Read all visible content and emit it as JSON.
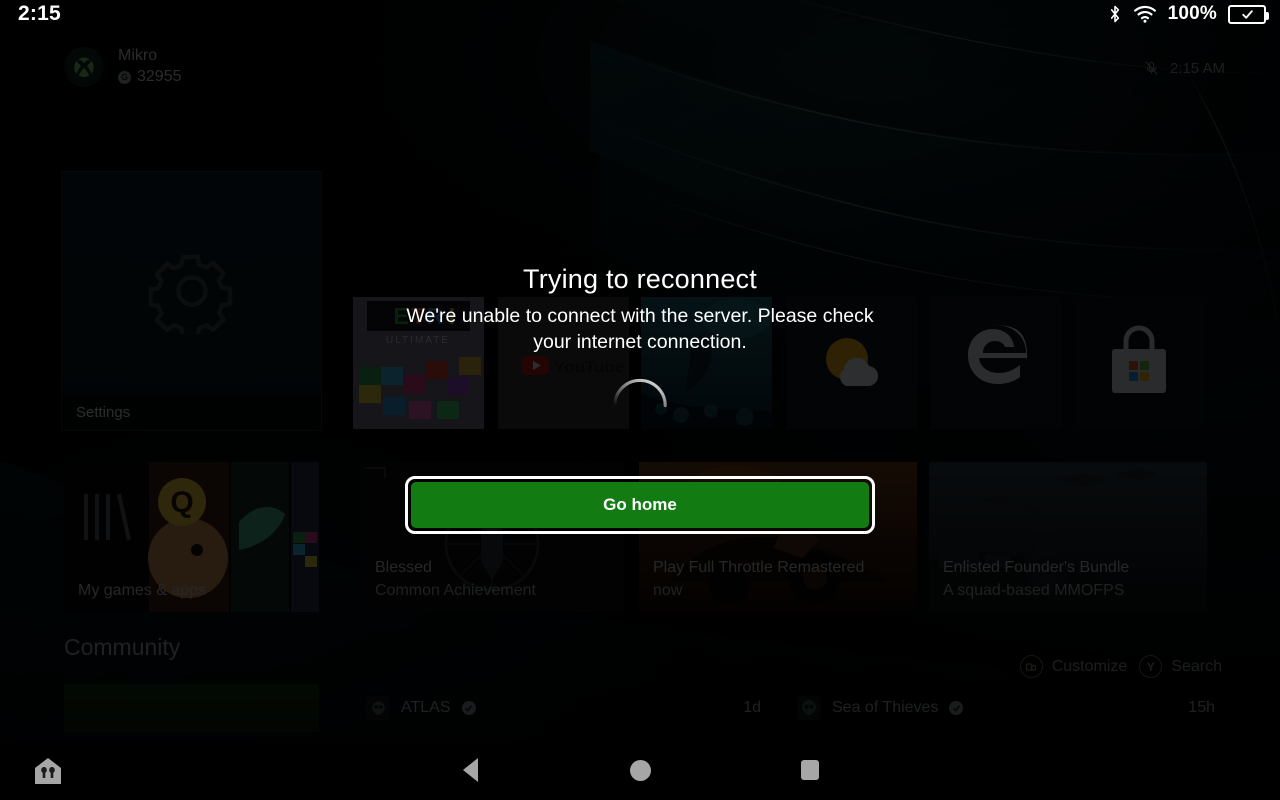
{
  "status_bar": {
    "time": "2:15",
    "battery_percent": "100%",
    "icons": [
      "bluetooth-icon",
      "wifi-icon",
      "battery-charged-icon"
    ]
  },
  "dashboard": {
    "profile": {
      "gamertag": "Mikro",
      "gamerscore": "32955",
      "gamerscore_badge": "G",
      "avatar_icon": "xbox-logo-icon"
    },
    "clock": {
      "time": "2:15 AM",
      "mic_icon": "microphone-muted-icon"
    },
    "pinned_tiles": [
      {
        "label": "Settings",
        "icon": "gear-icon"
      },
      {
        "label": "Tetris Ultimate",
        "icon": "tetris-tile-icon"
      },
      {
        "label": "YouTube",
        "icon": "youtube-icon"
      },
      {
        "label": "Subnautica",
        "icon": "diver-art-icon"
      },
      {
        "label": "Weather",
        "icon": "weather-sun-cloud-icon"
      },
      {
        "label": "Microsoft Edge",
        "icon": "edge-icon"
      },
      {
        "label": "Microsoft Store",
        "icon": "store-bag-icon"
      }
    ],
    "content_row": [
      {
        "title": "My games & apps",
        "subtitle": "",
        "icon": "library-books-icon"
      },
      {
        "title": "Blessed",
        "subtitle": "Common Achievement",
        "icon": "achievement-icon"
      },
      {
        "title": "Play Full Throttle Remastered",
        "subtitle": "now",
        "icon": ""
      },
      {
        "title": "Enlisted Founder's Bundle",
        "subtitle": "A squad-based MMOFPS",
        "icon": ""
      }
    ],
    "community": {
      "heading": "Community",
      "feed": [
        {
          "name": "ATLAS",
          "verified_icon": "verified-check-icon",
          "time": "1d"
        },
        {
          "name": "Sea of Thieves",
          "verified_icon": "verified-check-icon",
          "time": "15h"
        }
      ]
    },
    "hints": [
      {
        "label": "Customize",
        "glyph": "view-button-icon"
      },
      {
        "label": "Search",
        "glyph": "Y"
      }
    ]
  },
  "modal": {
    "title": "Trying to reconnect",
    "message": "We're unable to connect with the server. Please check your internet connection.",
    "spinner_icon": "loading-spinner-icon",
    "primary_button": "Go home",
    "accent_color": "#127C12"
  },
  "nav_bar": {
    "items": [
      "app-home-icon",
      "back-icon",
      "home-icon",
      "recents-icon"
    ]
  }
}
